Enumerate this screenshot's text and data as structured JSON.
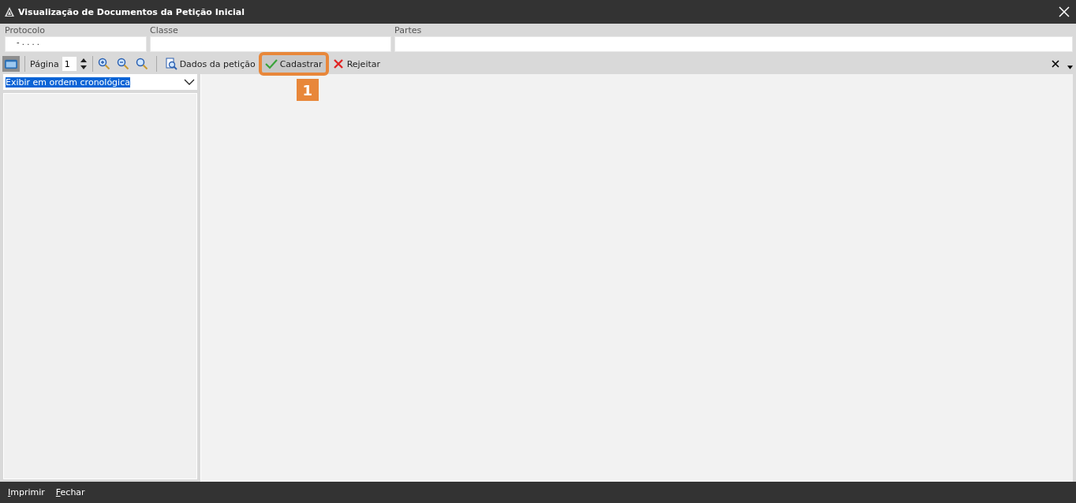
{
  "window": {
    "title": "Visualização de Documentos da Petição Inicial"
  },
  "fields": [
    {
      "label": "Protocolo",
      "value": "- .  . . ."
    },
    {
      "label": "Classe"
    },
    {
      "label": "Partes"
    }
  ],
  "toolbar": {
    "page_label": "Página",
    "page_value": "1",
    "buttons": [
      {
        "kind": "details",
        "label": "Dados da petição",
        "highlighted": false
      },
      {
        "kind": "register",
        "label": "Cadastrar",
        "highlighted": true
      },
      {
        "kind": "reject",
        "label": "Rejeitar",
        "highlighted": false
      }
    ]
  },
  "callout": {
    "number": "1"
  },
  "order_select": {
    "value": "Exibir em ordem cronológica"
  },
  "footer": {
    "buttons": [
      "Imprimir",
      "Fechar"
    ]
  }
}
